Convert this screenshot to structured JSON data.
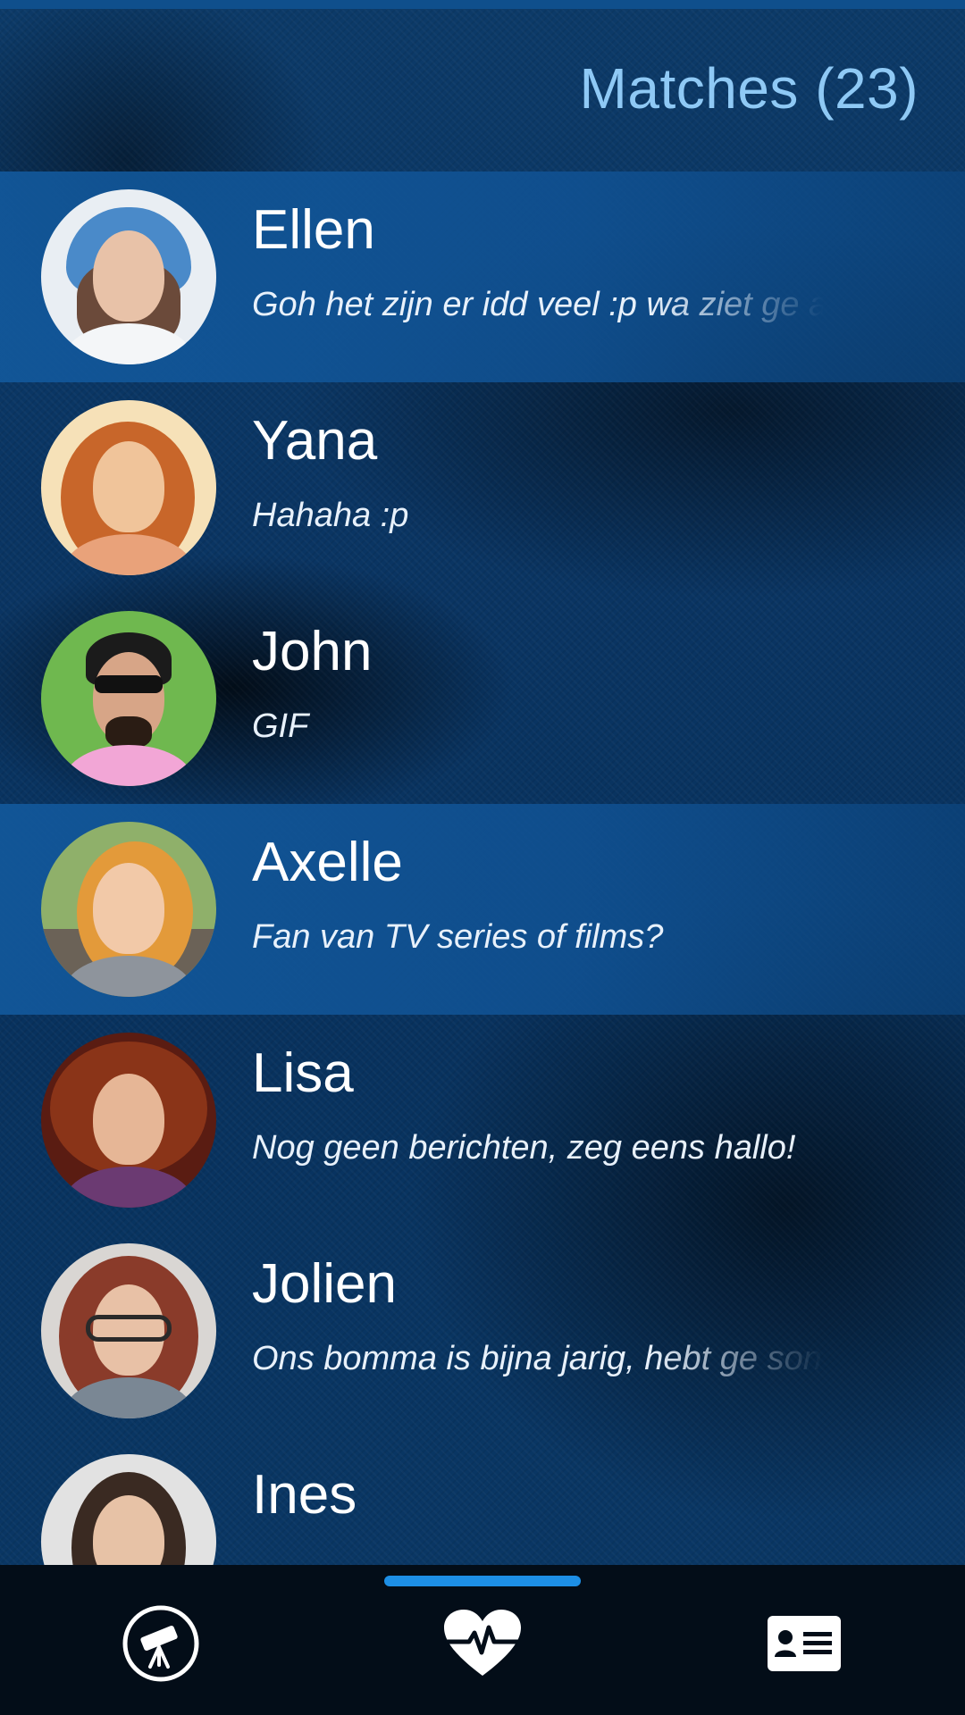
{
  "header": {
    "title": "Matches (23)"
  },
  "matches": [
    {
      "name": "Ellen",
      "last_message": "Goh het zijn er idd veel :p wa ziet ge a",
      "highlighted": true,
      "truncated": true,
      "avatar_colors": {
        "bg": "#e9eef3",
        "skin": "#e8c2a8",
        "hair": "#4a8ac9",
        "body": "#f4f6f8"
      }
    },
    {
      "name": "Yana",
      "last_message": "Hahaha :p",
      "highlighted": false,
      "truncated": false,
      "avatar_colors": {
        "bg": "#f6e1b8",
        "skin": "#f0c49a",
        "hair": "#c8662a",
        "body": "#e9a27a"
      }
    },
    {
      "name": "John",
      "last_message": "GIF",
      "highlighted": false,
      "truncated": false,
      "avatar_colors": {
        "bg": "#6fb84f",
        "skin": "#d7a587",
        "hair": "#1b1b1b",
        "body": "#f2a6d6"
      }
    },
    {
      "name": "Axelle",
      "last_message": "Fan van TV series of films?",
      "highlighted": true,
      "truncated": false,
      "avatar_colors": {
        "bg": "#8fb06a",
        "skin": "#f2c9a8",
        "hair": "#e39a3a",
        "body": "#8e949c"
      }
    },
    {
      "name": "Lisa",
      "last_message": "Nog geen berichten, zeg eens hallo!",
      "highlighted": false,
      "truncated": false,
      "avatar_colors": {
        "bg": "#5a1c12",
        "skin": "#e6b696",
        "hair": "#8a3418",
        "body": "#6b3a72"
      }
    },
    {
      "name": "Jolien",
      "last_message": "Ons bomma is bijna jarig, hebt ge son",
      "highlighted": false,
      "truncated": true,
      "avatar_colors": {
        "bg": "#d9d6d3",
        "skin": "#e8c1a6",
        "hair": "#8a3b2a",
        "body": "#7a8794"
      }
    },
    {
      "name": "Ines",
      "last_message": "",
      "highlighted": false,
      "truncated": true,
      "avatar_colors": {
        "bg": "#e2e2e2",
        "skin": "#e7c2a6",
        "hair": "#3a2a22",
        "body": "#2b2b2b"
      }
    }
  ],
  "nav": {
    "items": [
      {
        "icon": "telescope-icon",
        "active": false
      },
      {
        "icon": "heart-pulse-icon",
        "active": true
      },
      {
        "icon": "profile-card-icon",
        "active": false
      }
    ]
  },
  "colors": {
    "accent": "#1d8fe6",
    "header_title": "#8fc9f5",
    "highlight_row": "#12589b",
    "bottom_bar": "#030d18"
  }
}
